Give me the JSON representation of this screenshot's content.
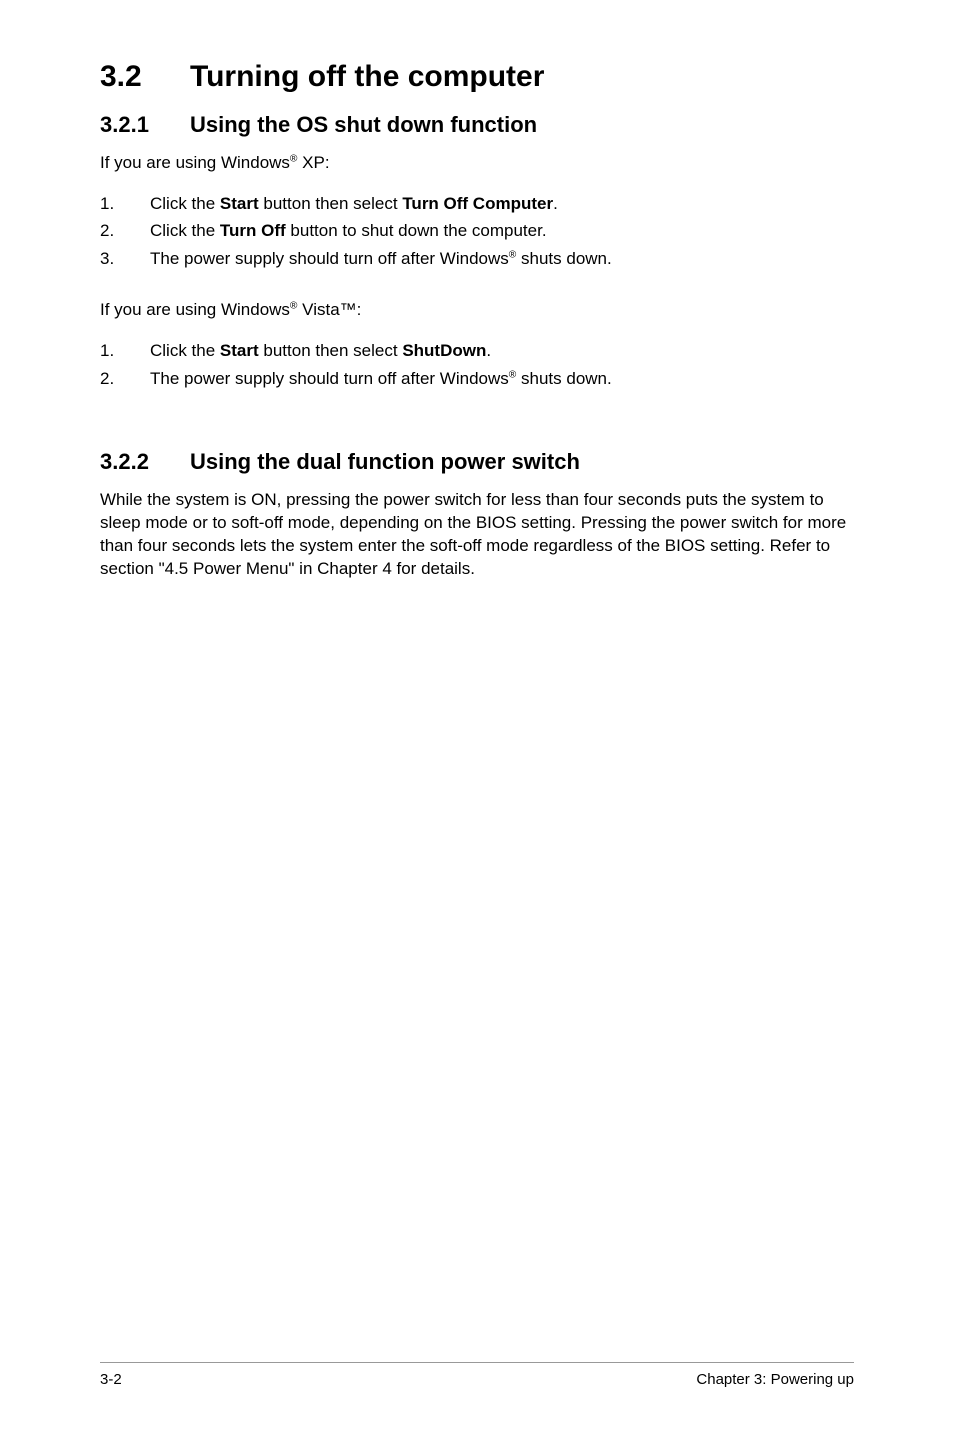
{
  "heading": {
    "number": "3.2",
    "title": "Turning off the computer"
  },
  "sub1": {
    "number": "3.2.1",
    "title": "Using the OS shut down function",
    "intro_xp_a": "If you are using Windows",
    "intro_xp_b": " XP:",
    "steps_xp": {
      "s1_a": "Click the ",
      "s1_b": "Start",
      "s1_c": " button then select ",
      "s1_d": "Turn Off Computer",
      "s1_e": ".",
      "s2_a": "Click the ",
      "s2_b": "Turn Off",
      "s2_c": " button to shut down the computer.",
      "s3_a": "The power supply should turn off after Windows",
      "s3_b": " shuts down."
    },
    "intro_vista_a": "If you are using Windows",
    "intro_vista_b": " Vista™:",
    "steps_vista": {
      "s1_a": "Click the ",
      "s1_b": "Start",
      "s1_c": " button then select ",
      "s1_d": "ShutDown",
      "s1_e": ".",
      "s2_a": "The power supply should turn off after Windows",
      "s2_b": " shuts down."
    }
  },
  "sub2": {
    "number": "3.2.2",
    "title": "Using the dual function power switch",
    "body": "While the system is ON, pressing the power switch for less than four seconds puts the system to sleep mode or to soft-off mode, depending on the BIOS setting. Pressing the power switch for more than four seconds lets the system enter the soft-off mode regardless of the BIOS setting. Refer to section \"4.5 Power Menu\" in Chapter 4 for details."
  },
  "footer": {
    "left": "3-2",
    "right": "Chapter 3: Powering up"
  },
  "glyphs": {
    "reg": "®"
  },
  "nums": {
    "n1": "1.",
    "n2": "2.",
    "n3": "3."
  }
}
